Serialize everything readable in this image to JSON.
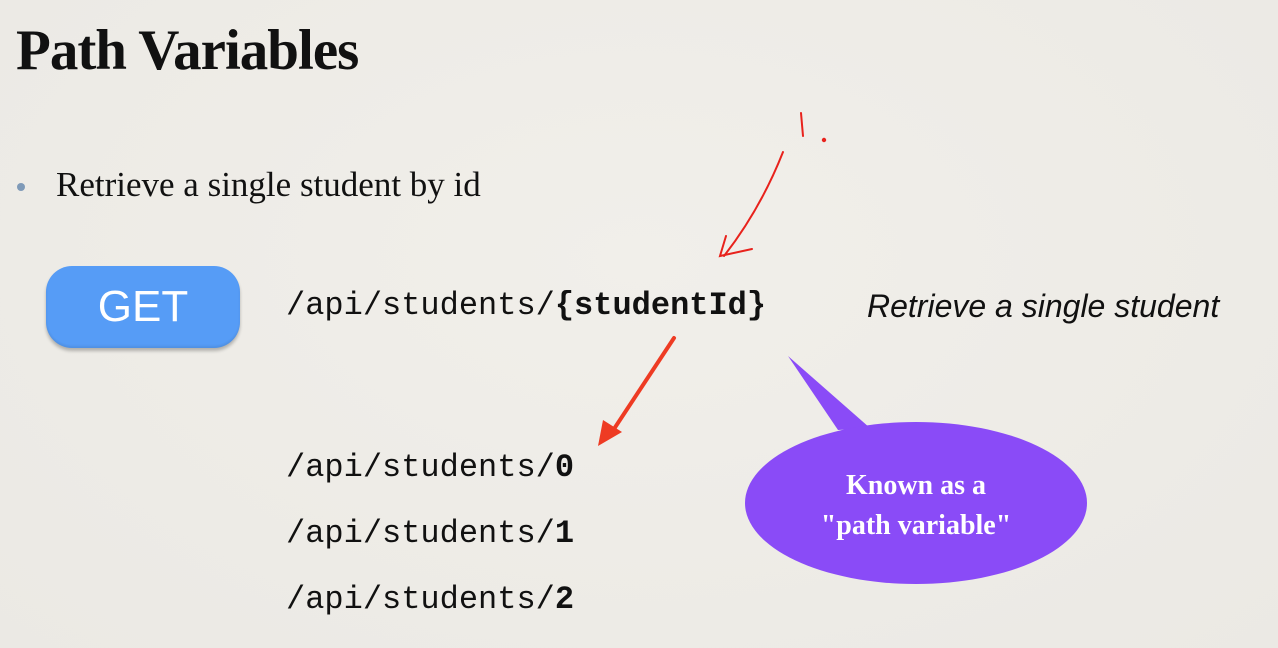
{
  "slide": {
    "title": "Path Variables",
    "bullet": "Retrieve a single student by id",
    "method_button": "GET",
    "endpoint_prefix": "/api/students/",
    "endpoint_variable": "{studentId}",
    "endpoint_description": "Retrieve a single student",
    "examples": [
      {
        "prefix": "/api/students/",
        "value": "0"
      },
      {
        "prefix": "/api/students/",
        "value": "1"
      },
      {
        "prefix": "/api/students/",
        "value": "2"
      }
    ],
    "callout_line1": "Known as a",
    "callout_line2": "\"path variable\"",
    "handwritten_annotation": "1."
  },
  "colors": {
    "background": "#eeece7",
    "get_button": "#569cf6",
    "callout": "#8a4bf7",
    "arrow": "#ee3b23",
    "pen": "#e8221c"
  }
}
